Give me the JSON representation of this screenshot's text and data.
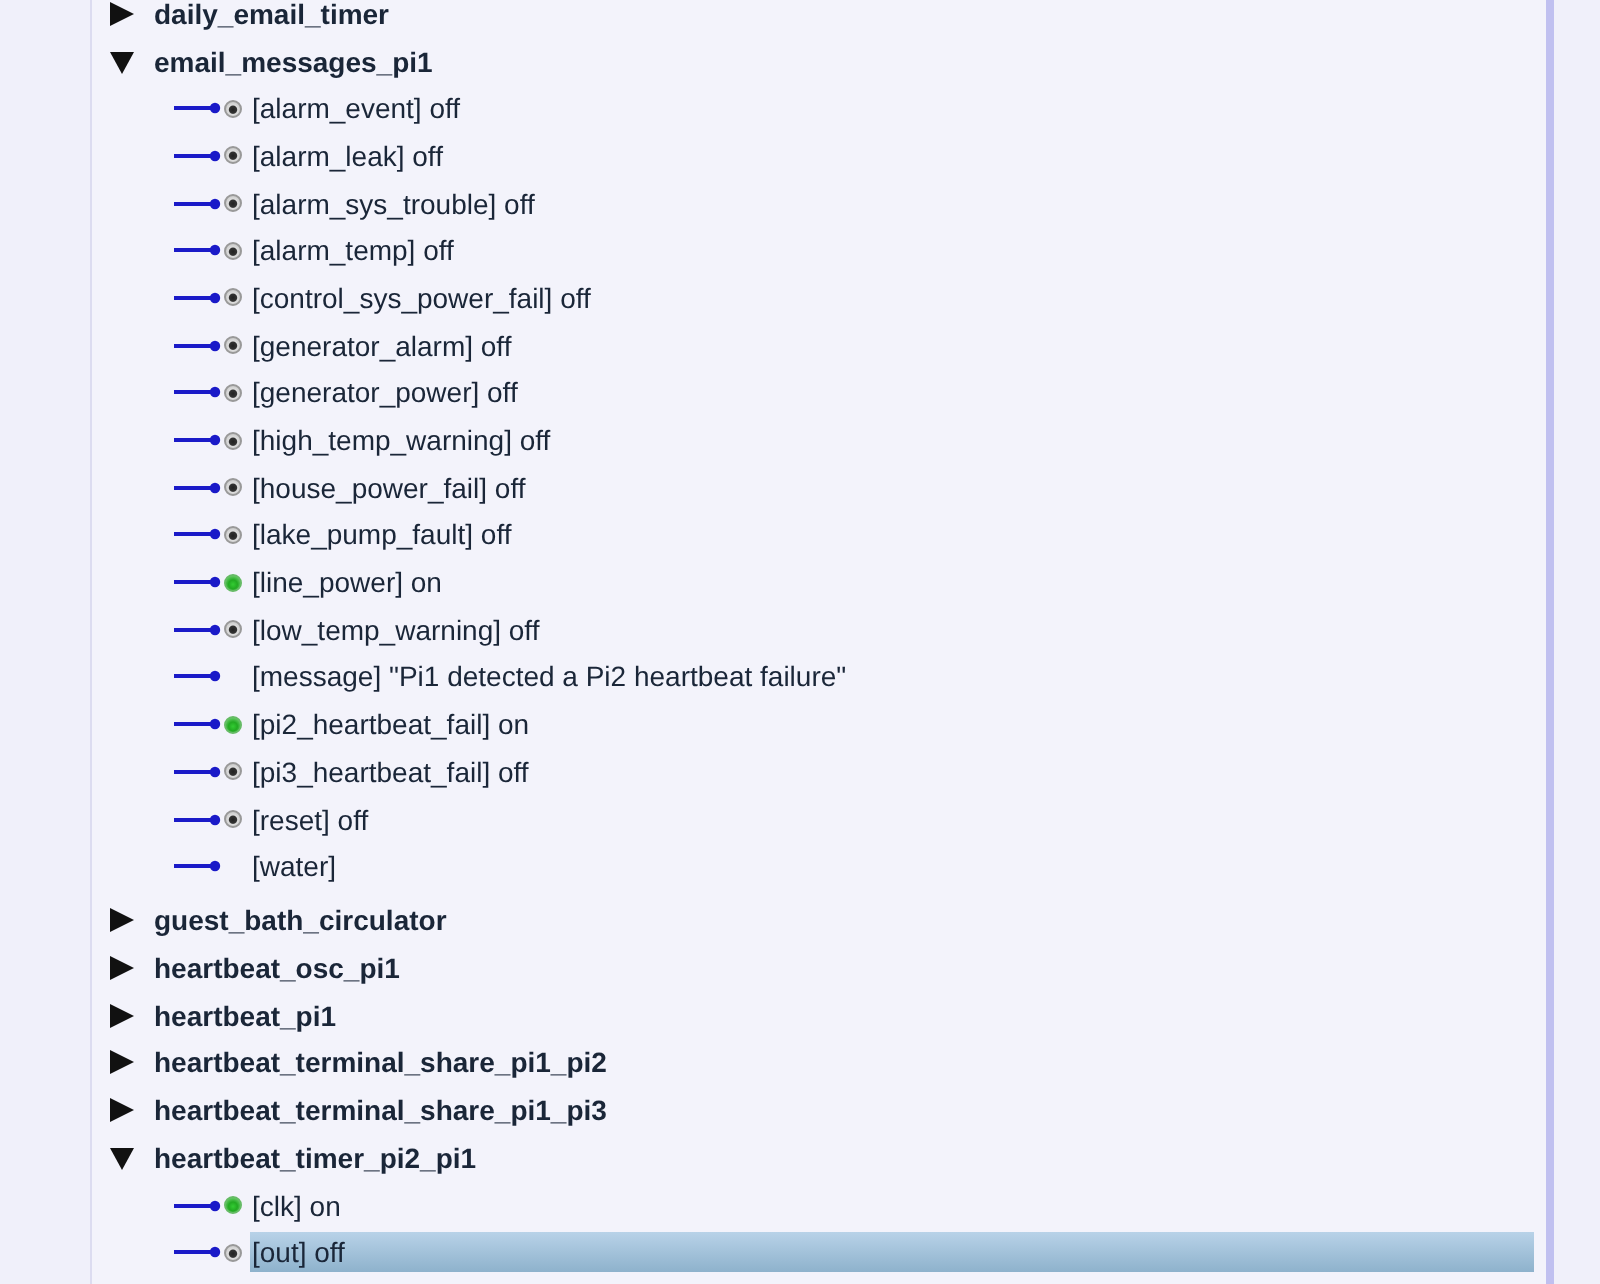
{
  "groups": [
    {
      "name": "daily_email_timer",
      "expanded": false
    },
    {
      "name": "email_messages_pi1",
      "expanded": true,
      "children": [
        {
          "kind": "binary",
          "text": "[alarm_event] off",
          "on": false,
          "selected": false
        },
        {
          "kind": "binary",
          "text": "[alarm_leak] off",
          "on": false,
          "selected": false
        },
        {
          "kind": "binary",
          "text": "[alarm_sys_trouble] off",
          "on": false,
          "selected": false
        },
        {
          "kind": "binary",
          "text": "[alarm_temp] off",
          "on": false,
          "selected": false
        },
        {
          "kind": "binary",
          "text": "[control_sys_power_fail] off",
          "on": false,
          "selected": false
        },
        {
          "kind": "binary",
          "text": "[generator_alarm] off",
          "on": false,
          "selected": false
        },
        {
          "kind": "binary",
          "text": "[generator_power] off",
          "on": false,
          "selected": false
        },
        {
          "kind": "binary",
          "text": "[high_temp_warning] off",
          "on": false,
          "selected": false
        },
        {
          "kind": "binary",
          "text": "[house_power_fail] off",
          "on": false,
          "selected": false
        },
        {
          "kind": "binary",
          "text": "[lake_pump_fault] off",
          "on": false,
          "selected": false
        },
        {
          "kind": "binary",
          "text": "[line_power] on",
          "on": true,
          "selected": false
        },
        {
          "kind": "binary",
          "text": "[low_temp_warning] off",
          "on": false,
          "selected": false
        },
        {
          "kind": "value",
          "text": "[message] \"Pi1 detected a Pi2 heartbeat failure\"",
          "selected": false
        },
        {
          "kind": "binary",
          "text": "[pi2_heartbeat_fail] on",
          "on": true,
          "selected": false
        },
        {
          "kind": "binary",
          "text": "[pi3_heartbeat_fail] off",
          "on": false,
          "selected": false
        },
        {
          "kind": "binary",
          "text": "[reset] off",
          "on": false,
          "selected": false
        },
        {
          "kind": "value",
          "text": "[water]",
          "selected": false
        }
      ]
    },
    {
      "name": "guest_bath_circulator",
      "expanded": false
    },
    {
      "name": "heartbeat_osc_pi1",
      "expanded": false
    },
    {
      "name": "heartbeat_pi1",
      "expanded": false
    },
    {
      "name": "heartbeat_terminal_share_pi1_pi2",
      "expanded": false
    },
    {
      "name": "heartbeat_terminal_share_pi1_pi3",
      "expanded": false
    },
    {
      "name": "heartbeat_timer_pi2_pi1",
      "expanded": true,
      "children": [
        {
          "kind": "binary",
          "text": "[clk] on",
          "on": true,
          "selected": false
        },
        {
          "kind": "binary",
          "text": "[out] off",
          "on": false,
          "selected": true
        }
      ]
    }
  ]
}
